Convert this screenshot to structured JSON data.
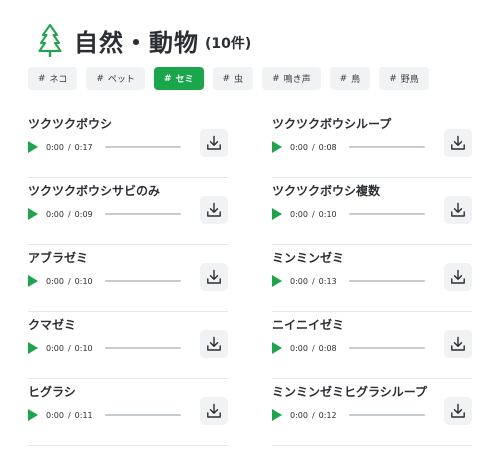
{
  "header": {
    "icon": "tree-icon",
    "title": "自然・動物",
    "count": "(10件)"
  },
  "tags": [
    {
      "hash": "#",
      "label": "ネコ",
      "active": false
    },
    {
      "hash": "#",
      "label": "ペット",
      "active": false
    },
    {
      "hash": "#",
      "label": "セミ",
      "active": true
    },
    {
      "hash": "#",
      "label": "虫",
      "active": false
    },
    {
      "hash": "#",
      "label": "鳴き声",
      "active": false
    },
    {
      "hash": "#",
      "label": "鳥",
      "active": false
    },
    {
      "hash": "#",
      "label": "野鳥",
      "active": false
    }
  ],
  "sounds": [
    {
      "title": "ツクツクボウシ",
      "current": "0:00",
      "sep": "/",
      "duration": "0:17",
      "progress": 0
    },
    {
      "title": "ツクツクボウシループ",
      "current": "0:00",
      "sep": "/",
      "duration": "0:08",
      "progress": 0
    },
    {
      "title": "ツクツクボウシサビのみ",
      "current": "0:00",
      "sep": "/",
      "duration": "0:09",
      "progress": 0
    },
    {
      "title": "ツクツクボウシ複数",
      "current": "0:00",
      "sep": "/",
      "duration": "0:10",
      "progress": 0
    },
    {
      "title": "アブラゼミ",
      "current": "0:00",
      "sep": "/",
      "duration": "0:10",
      "progress": 0
    },
    {
      "title": "ミンミンゼミ",
      "current": "0:00",
      "sep": "/",
      "duration": "0:13",
      "progress": 0
    },
    {
      "title": "クマゼミ",
      "current": "0:00",
      "sep": "/",
      "duration": "0:10",
      "progress": 0
    },
    {
      "title": "ニイニイゼミ",
      "current": "0:00",
      "sep": "/",
      "duration": "0:08",
      "progress": 0
    },
    {
      "title": "ヒグラシ",
      "current": "0:00",
      "sep": "/",
      "duration": "0:11",
      "progress": 0
    },
    {
      "title": "ミンミンゼミヒグラシループ",
      "current": "0:00",
      "sep": "/",
      "duration": "0:12",
      "progress": 0
    }
  ],
  "colors": {
    "accent": "#1aa64a",
    "text": "#2b2f33",
    "tag_bg": "#f1f2f4",
    "track": "#c6cbd1"
  },
  "icons": {
    "play": "play-icon",
    "download": "download-icon"
  }
}
